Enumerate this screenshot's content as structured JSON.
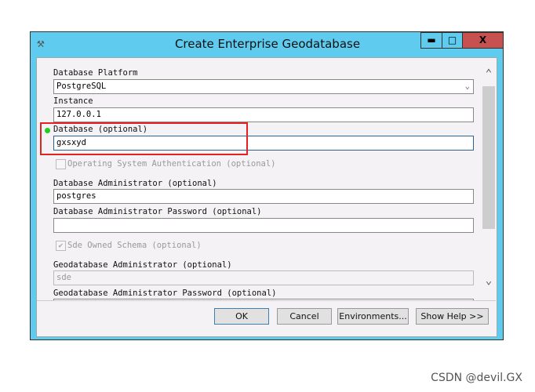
{
  "window": {
    "title": "Create Enterprise Geodatabase",
    "minimize": "▬",
    "maximize": "□",
    "close": "X"
  },
  "fields": {
    "platform_label": "Database Platform",
    "platform_value": "PostgreSQL",
    "instance_label": "Instance",
    "instance_value": "127.0.0.1",
    "database_label": "Database (optional)",
    "database_value": "gxsxyd",
    "os_auth_label": "Operating System Authentication (optional)",
    "os_auth_checked": false,
    "dba_label": "Database Administrator (optional)",
    "dba_value": "postgres",
    "dba_pwd_label": "Database Administrator Password (optional)",
    "dba_pwd_value": "",
    "sde_schema_label": "Sde Owned Schema (optional)",
    "sde_schema_checked": true,
    "gdb_admin_label": "Geodatabase Administrator (optional)",
    "gdb_admin_value": "sde",
    "gdb_pwd_label": "Geodatabase Administrator Password (optional)"
  },
  "buttons": {
    "ok": "OK",
    "cancel": "Cancel",
    "environments": "Environments...",
    "show_help": "Show Help >>"
  },
  "colors": {
    "titlebar": "#5ecbef",
    "close": "#c75050",
    "highlight": "#e52222",
    "indicator": "#22cc22"
  },
  "watermark": "CSDN @devil.GX"
}
